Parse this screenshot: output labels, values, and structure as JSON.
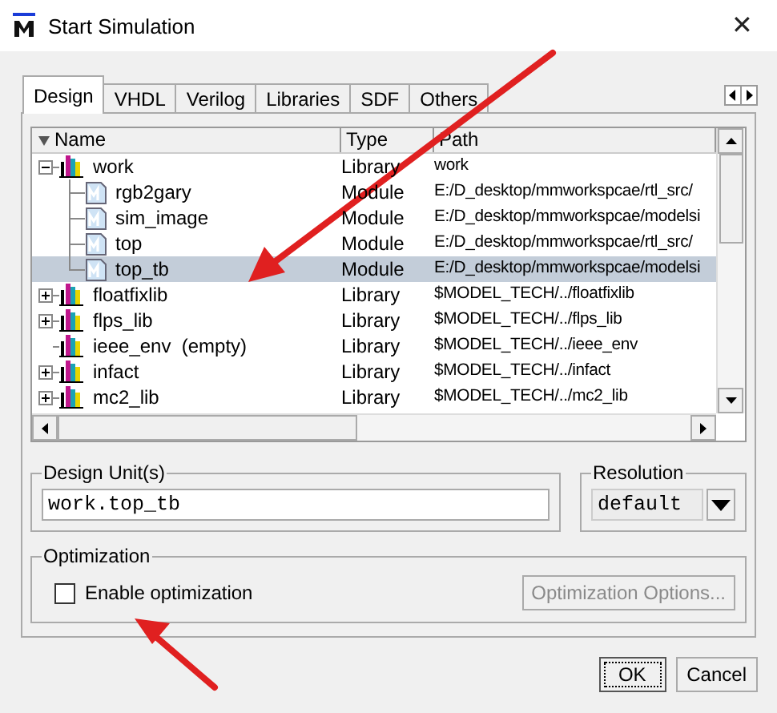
{
  "window": {
    "title": "Start Simulation",
    "close": "✕"
  },
  "tabs": [
    {
      "label": "Design",
      "selected": true
    },
    {
      "label": "VHDL",
      "selected": false
    },
    {
      "label": "Verilog",
      "selected": false
    },
    {
      "label": "Libraries",
      "selected": false
    },
    {
      "label": "SDF",
      "selected": false
    },
    {
      "label": "Others",
      "selected": false
    }
  ],
  "tree": {
    "columns": [
      "Name",
      "Type",
      "Path"
    ],
    "items": [
      {
        "kind": "library",
        "name": "work",
        "type": "Library",
        "path": "work",
        "expanded": true,
        "selected": false,
        "children": [
          {
            "kind": "module",
            "name": "rgb2gary",
            "type": "Module",
            "path": "E:/D_desktop/mmworkspcae/rtl_src/",
            "selected": false
          },
          {
            "kind": "module",
            "name": "sim_image",
            "type": "Module",
            "path": "E:/D_desktop/mmworkspcae/modelsi",
            "selected": false
          },
          {
            "kind": "module",
            "name": "top",
            "type": "Module",
            "path": "E:/D_desktop/mmworkspcae/rtl_src/",
            "selected": false
          },
          {
            "kind": "module",
            "name": "top_tb",
            "type": "Module",
            "path": "E:/D_desktop/mmworkspcae/modelsi",
            "selected": true
          }
        ]
      },
      {
        "kind": "library",
        "name": "floatfixlib",
        "type": "Library",
        "path": "$MODEL_TECH/../floatfixlib",
        "expanded": false,
        "selected": false
      },
      {
        "kind": "library",
        "name": "flps_lib",
        "type": "Library",
        "path": "$MODEL_TECH/../flps_lib",
        "expanded": false,
        "selected": false
      },
      {
        "kind": "library",
        "name": "ieee_env  (empty)",
        "type": "Library",
        "path": "$MODEL_TECH/../ieee_env",
        "selected": false
      },
      {
        "kind": "library",
        "name": "infact",
        "type": "Library",
        "path": "$MODEL_TECH/../infact",
        "expanded": false,
        "selected": false
      },
      {
        "kind": "library",
        "name": "mc2_lib",
        "type": "Library",
        "path": "$MODEL_TECH/../mc2_lib",
        "expanded": false,
        "selected": false
      }
    ]
  },
  "design_unit": {
    "label": "Design Unit(s)",
    "value": "work.top_tb"
  },
  "resolution": {
    "label": "Resolution",
    "value": "default"
  },
  "optimization": {
    "label": "Optimization",
    "checkbox": {
      "label": "Enable optimization",
      "checked": false
    },
    "options_button": {
      "label": "Optimization Options...",
      "disabled": true
    }
  },
  "buttons": [
    {
      "label": "OK",
      "focused": true
    },
    {
      "label": "Cancel",
      "focused": false
    }
  ]
}
